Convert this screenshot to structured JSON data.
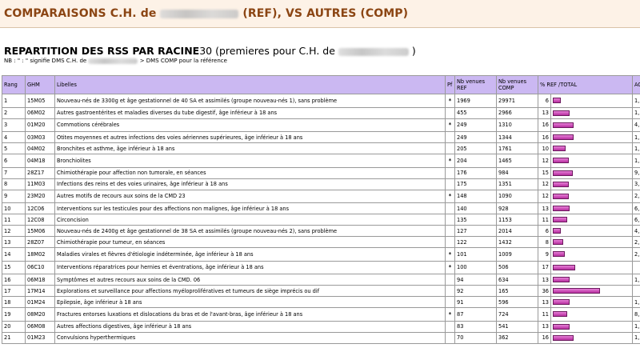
{
  "header": {
    "title_prefix": "COMPARAISONS C.H. de",
    "title_suffix": "(REF), VS AUTRES (COMP)"
  },
  "section": {
    "title_bold": "REPARTITION DES RSS PAR RACINE",
    "title_rest": "30 (premieres pour C.H. de",
    "title_close": ")",
    "note_prefix": "NB : \" : \" signifie DMS C.H. de",
    "note_suffix": "> DMS COMP pour la référence"
  },
  "colors": {
    "header_bg": "#cbb8f2",
    "bar": "#c93bb2",
    "banner": "#fdf2e7",
    "title": "#8b4513"
  },
  "table": {
    "columns": [
      "Rang",
      "GHM",
      "Libelles",
      "Pf",
      "Nb venues REF",
      "Nb venues COMP",
      "% REF /TOTAL",
      "AC"
    ],
    "rows": [
      {
        "rang": "1",
        "ghm": "15M05",
        "libelle": "Nouveau-nés de 3300g et âge gestationnel de 40 SA et assimilés (groupe nouveau-nés 1), sans problème",
        "pf": "*",
        "ref": "1969",
        "comp": "29971",
        "pct": "6",
        "pct_value": 6,
        "ac": "1,"
      },
      {
        "rang": "2",
        "ghm": "06M02",
        "libelle": "Autres gastroentérites et maladies diverses du tube digestif, âge inférieur à 18 ans",
        "pf": "",
        "ref": "455",
        "comp": "2966",
        "pct": "13",
        "pct_value": 13,
        "ac": "1,"
      },
      {
        "rang": "3",
        "ghm": "01M20",
        "libelle": "Commotions cérébrales",
        "pf": "*",
        "ref": "249",
        "comp": "1310",
        "pct": "16",
        "pct_value": 16,
        "ac": "4,"
      },
      {
        "rang": "4",
        "ghm": "03M03",
        "libelle": "Otites moyennes et autres infections des voies aériennes supérieures, âge inférieur à 18 ans",
        "pf": "",
        "ref": "249",
        "comp": "1344",
        "pct": "16",
        "pct_value": 16,
        "ac": "1,"
      },
      {
        "rang": "5",
        "ghm": "04M02",
        "libelle": "Bronchites et asthme, âge inférieur à 18 ans",
        "pf": "",
        "ref": "205",
        "comp": "1761",
        "pct": "10",
        "pct_value": 10,
        "ac": "1,"
      },
      {
        "rang": "6",
        "ghm": "04M18",
        "libelle": "Bronchiolites",
        "pf": "*",
        "ref": "204",
        "comp": "1465",
        "pct": "12",
        "pct_value": 12,
        "ac": "1,"
      },
      {
        "rang": "7",
        "ghm": "28Z17",
        "libelle": "Chimiothérapie pour affection non tumorale, en séances",
        "pf": "",
        "ref": "176",
        "comp": "984",
        "pct": "15",
        "pct_value": 15,
        "ac": "9,"
      },
      {
        "rang": "8",
        "ghm": "11M03",
        "libelle": "Infections des reins et des voies urinaires, âge inférieur à 18 ans",
        "pf": "",
        "ref": "175",
        "comp": "1351",
        "pct": "12",
        "pct_value": 12,
        "ac": "3,"
      },
      {
        "rang": "9",
        "ghm": "23M20",
        "libelle": "Autres motifs de recours aux soins de la CMD 23",
        "pf": "*",
        "ref": "148",
        "comp": "1090",
        "pct": "12",
        "pct_value": 12,
        "ac": "2,"
      },
      {
        "rang": "10",
        "ghm": "12C06",
        "libelle": "Interventions sur les testicules pour des affections non malignes, âge inférieur à 18 ans",
        "pf": "",
        "ref": "140",
        "comp": "928",
        "pct": "13",
        "pct_value": 13,
        "ac": "6,"
      },
      {
        "rang": "11",
        "ghm": "12C08",
        "libelle": "Circoncision",
        "pf": "",
        "ref": "135",
        "comp": "1153",
        "pct": "11",
        "pct_value": 11,
        "ac": "6,"
      },
      {
        "rang": "12",
        "ghm": "15M06",
        "libelle": "Nouveau-nés de 2400g et âge gestationnel de 38 SA et assimilés (groupe nouveau-nés 2), sans problème",
        "pf": "",
        "ref": "127",
        "comp": "2014",
        "pct": "6",
        "pct_value": 6,
        "ac": "4,"
      },
      {
        "rang": "13",
        "ghm": "28Z07",
        "libelle": "Chimiothérapie pour tumeur, en séances",
        "pf": "",
        "ref": "122",
        "comp": "1432",
        "pct": "8",
        "pct_value": 8,
        "ac": "2,"
      },
      {
        "rang": "14",
        "ghm": "18M02",
        "libelle": "Maladies virales et fièvres d'étiologie indéterminée, âge inférieur à 18 ans",
        "pf": "*",
        "ref": "101",
        "comp": "1009",
        "pct": "9",
        "pct_value": 9,
        "ac": "2,"
      },
      {
        "rang": "15",
        "ghm": "06C10",
        "libelle": "Interventions réparatrices pour hernies et éventrations, âge inférieur à 18 ans",
        "pf": "*",
        "ref": "100",
        "comp": "506",
        "pct": "17",
        "pct_value": 17,
        "ac": ""
      },
      {
        "rang": "16",
        "ghm": "06M18",
        "libelle": "Symptômes et autres recours aux soins de la CMD. 06",
        "pf": "",
        "ref": "94",
        "comp": "634",
        "pct": "13",
        "pct_value": 13,
        "ac": "1,"
      },
      {
        "rang": "17",
        "ghm": "17M14",
        "libelle": "Explorations et surveillance pour affections myéloprolifératives et tumeurs de siège imprécis ou dif",
        "pf": "",
        "ref": "92",
        "comp": "165",
        "pct": "36",
        "pct_value": 36,
        "ac": ""
      },
      {
        "rang": "18",
        "ghm": "01M24",
        "libelle": "Epilepsie, âge inférieur à 18 ans",
        "pf": "",
        "ref": "91",
        "comp": "596",
        "pct": "13",
        "pct_value": 13,
        "ac": "1,"
      },
      {
        "rang": "19",
        "ghm": "08M20",
        "libelle": "Fractures entorses luxations et dislocations du bras et de l'avant-bras, âge inférieur à 18 ans",
        "pf": "*",
        "ref": "87",
        "comp": "724",
        "pct": "11",
        "pct_value": 11,
        "ac": "8,"
      },
      {
        "rang": "20",
        "ghm": "06M08",
        "libelle": "Autres affections digestives, âge inférieur à 18 ans",
        "pf": "",
        "ref": "83",
        "comp": "541",
        "pct": "13",
        "pct_value": 13,
        "ac": "1,"
      },
      {
        "rang": "21",
        "ghm": "01M23",
        "libelle": "Convulsions hyperthermiques",
        "pf": "",
        "ref": "70",
        "comp": "362",
        "pct": "16",
        "pct_value": 16,
        "ac": "1,"
      }
    ]
  }
}
